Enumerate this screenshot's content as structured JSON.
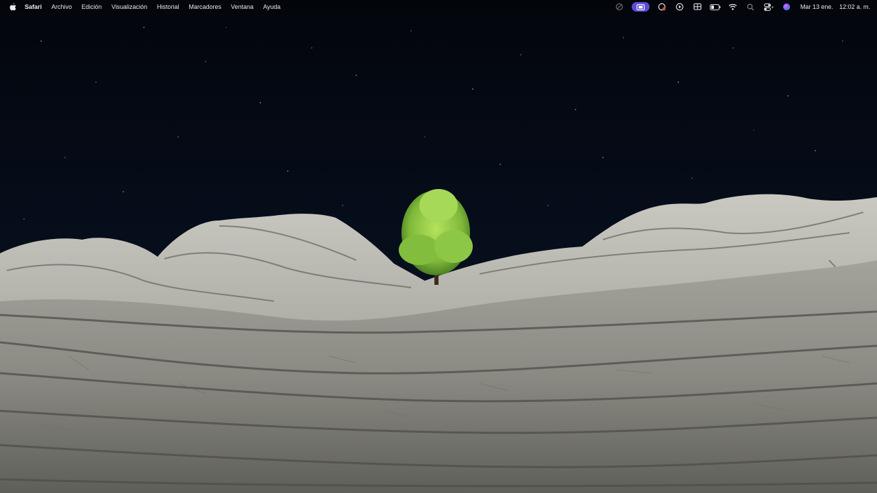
{
  "menubar": {
    "app_name": "Safari",
    "menus": [
      "Archivo",
      "Edición",
      "Visualización",
      "Historial",
      "Marcadores",
      "Ventana",
      "Ayuda"
    ],
    "status_icons": [
      "screen-record-icon",
      "stage-manager-icon",
      "vpn-icon",
      "play-icon",
      "screen-mirroring-icon",
      "battery-icon",
      "wifi-icon",
      "spotlight-icon",
      "control-center-icon",
      "siri-icon"
    ],
    "date": "Mar 13 ene.",
    "time": "12:02 a. m."
  },
  "wallpaper": {
    "description_colors": {
      "sky": "#04060d",
      "rock": "#a7a79f",
      "tree": "#8fcf4a"
    }
  },
  "colors": {
    "menubar_text": "#e9e9ee",
    "accent_pill": "#5b4bd6"
  }
}
